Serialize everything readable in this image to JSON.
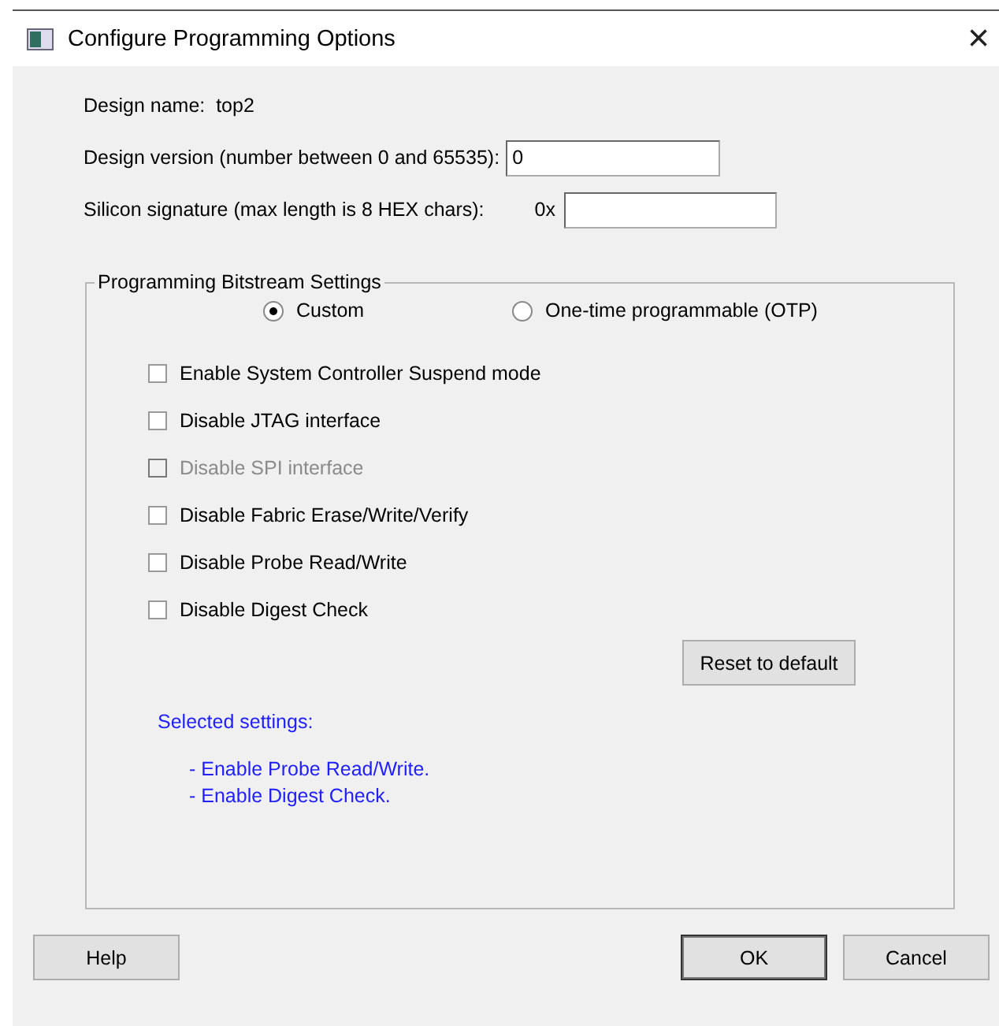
{
  "window": {
    "title": "Configure Programming Options",
    "close": "×"
  },
  "fields": [
    {
      "kind": "static",
      "label": "Design name:",
      "value": "top2"
    },
    {
      "kind": "input",
      "label": "Design version (number between 0 and 65535):",
      "value": "0"
    },
    {
      "kind": "input",
      "label": "Silicon signature (max length is 8 HEX chars):",
      "prefix": "0x"
    }
  ],
  "group": {
    "title": "Programming Bitstream Settings",
    "modes": [
      {
        "label": "Custom",
        "selected": true
      },
      {
        "label": "One-time programmable (OTP)",
        "selected": false
      }
    ],
    "options": [
      {
        "label": "Enable System Controller Suspend mode",
        "checked": false,
        "disabled": false
      },
      {
        "label": "Disable JTAG interface",
        "checked": false,
        "disabled": false
      },
      {
        "label": "Disable SPI interface",
        "checked": false,
        "disabled": true
      },
      {
        "label": "Disable Fabric Erase/Write/Verify",
        "checked": false,
        "disabled": false
      },
      {
        "label": "Disable Probe Read/Write",
        "checked": false,
        "disabled": false
      },
      {
        "label": "Disable Digest Check",
        "checked": false,
        "disabled": false
      }
    ],
    "reset_button": "Reset to default",
    "summary_title": "Selected settings:",
    "summary_lines": [
      "- Enable Probe Read/Write.",
      "- Enable Digest Check."
    ]
  },
  "buttons": [
    {
      "label": "Help",
      "kind": "left"
    },
    {
      "label": "OK",
      "kind": "default"
    },
    {
      "label": "Cancel",
      "kind": "normal"
    }
  ]
}
